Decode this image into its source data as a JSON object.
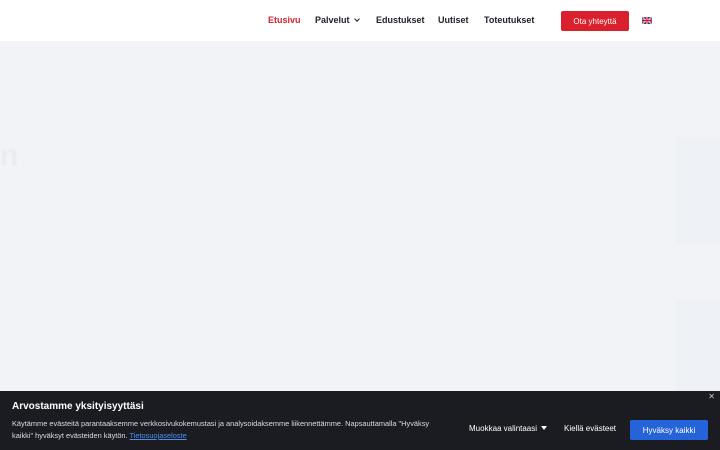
{
  "nav": {
    "items": [
      {
        "label": "Etusivu"
      },
      {
        "label": "Palvelut"
      },
      {
        "label": "Edustukset"
      },
      {
        "label": "Uutiset"
      },
      {
        "label": "Toteutukset"
      }
    ],
    "cta_label": "Ota yhteyttä",
    "language_icon": "uk-flag-icon"
  },
  "hero": {
    "ghost_letter": "n"
  },
  "cookie": {
    "title": "Arvostamme yksityisyyttäsi",
    "text": "Käytämme evästeitä parantaaksemme verkkosivukokemustasi ja analysoidaksemme liikennettämme. Napsauttamalla \"Hyväksy kaikki\" hyväksyt evästeiden käytön.",
    "privacy_link": "Tietosuojaseloste",
    "customize_label": "Muokkaa valintaasi",
    "reject_label": "Kiellä evästeet",
    "accept_label": "Hyväksy kaikki",
    "close_icon": "close-icon"
  },
  "colors": {
    "accent_red": "#d9202c",
    "accept_blue": "#2563d9",
    "banner_bg": "#1b1b22",
    "hero_bg": "#f1f3f6"
  }
}
